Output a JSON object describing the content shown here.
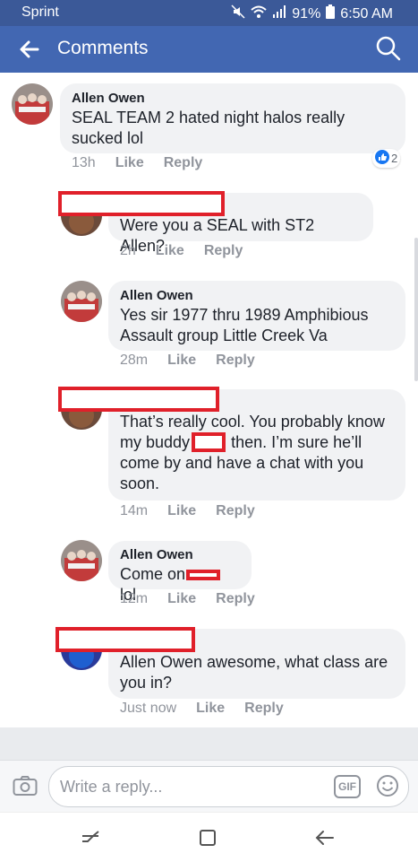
{
  "status": {
    "carrier": "Sprint",
    "battery": "91%",
    "time": "6:50 AM"
  },
  "header": {
    "title": "Comments"
  },
  "comments": [
    {
      "name": "Allen Owen",
      "text": [
        "SEAL TEAM 2 hated night halos really",
        "sucked lol"
      ],
      "time": "13h",
      "like": "Like",
      "reply": "Reply",
      "reactions": "2"
    },
    {
      "name": "",
      "text": [
        "Were you a SEAL with ST2 Allen?"
      ],
      "time": "2h",
      "like": "Like",
      "reply": "Reply"
    },
    {
      "name": "Allen Owen",
      "text": [
        "Yes sir 1977 thru 1989 Amphibious",
        "Assault group Little Creek Va"
      ],
      "time": "28m",
      "like": "Like",
      "reply": "Reply"
    },
    {
      "name": "",
      "text": [
        "That’s really cool. You probably know",
        "my buddy",
        "then. I’m sure he’ll",
        "come by and have a chat with you",
        "soon."
      ],
      "time": "14m",
      "like": "Like",
      "reply": "Reply"
    },
    {
      "name": "Allen Owen",
      "text": [
        "Come on",
        "lol"
      ],
      "time": "12m",
      "like": "Like",
      "reply": "Reply"
    },
    {
      "name": "",
      "text": [
        "Allen Owen awesome,  what class are",
        "you in?"
      ],
      "time": "Just now",
      "like": "Like",
      "reply": "Reply"
    }
  ],
  "composer": {
    "placeholder": "Write a reply...",
    "gif": "GIF"
  },
  "colors": {
    "brand": "#4267b2",
    "statusbar": "#3b5998",
    "redaction": "#e0202a",
    "bubble": "#f1f2f4"
  }
}
